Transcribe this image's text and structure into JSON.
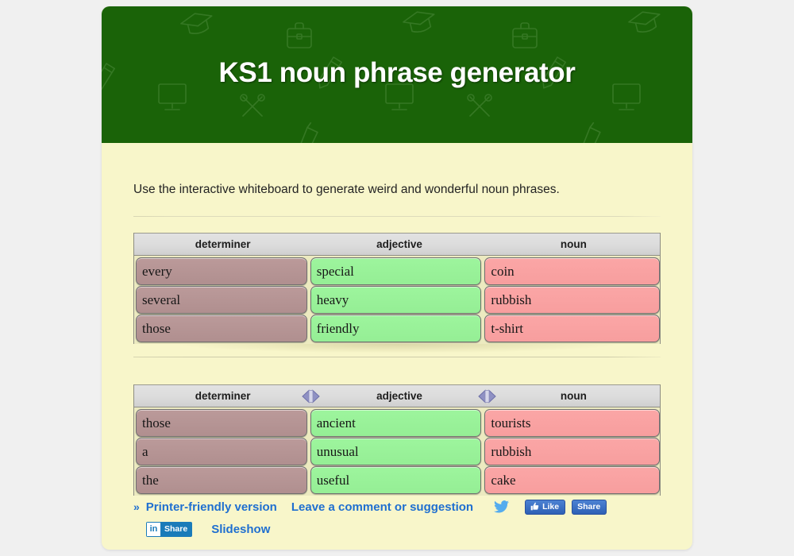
{
  "page": {
    "background_color": "#f0f0f0",
    "card_background": "#f8f6ca",
    "banner_color": "#1a6308",
    "accent_link_color": "#1f6fd0"
  },
  "banner": {
    "title": "KS1 noun phrase generator",
    "decorative_icons": [
      "graduation-cap-icon",
      "briefcase-icon",
      "pencil-icon",
      "monitor-icon",
      "scissors-icon",
      "paint-roller-icon"
    ]
  },
  "intro": {
    "text": "Use the interactive whiteboard to generate weird and wonderful noun phrases."
  },
  "boards": [
    {
      "name": "noun-phrase-board-1",
      "columns": [
        "determiner",
        "adjective",
        "noun"
      ],
      "has_resize_grips": false,
      "column_colors": [
        "#b99696",
        "#99f299",
        "#f9a2a2"
      ],
      "rows": [
        [
          "every",
          "special",
          "coin"
        ],
        [
          "several",
          "heavy",
          "rubbish"
        ],
        [
          "those",
          "friendly",
          "t-shirt"
        ]
      ]
    },
    {
      "name": "noun-phrase-board-2",
      "columns": [
        "determiner",
        "adjective",
        "noun"
      ],
      "has_resize_grips": true,
      "column_colors": [
        "#b99696",
        "#99f299",
        "#f9a2a2"
      ],
      "rows": [
        [
          "those",
          "ancient",
          "tourists"
        ],
        [
          "a",
          "unusual",
          "rubbish"
        ],
        [
          "the",
          "useful",
          "cake"
        ]
      ]
    }
  ],
  "footer": {
    "bullet": "»",
    "printer_link": "Printer-friendly version",
    "comment_link": "Leave a comment or suggestion",
    "slideshow_link": "Slideshow",
    "twitter_icon": "twitter-bird-icon",
    "facebook_like_label": "Like",
    "facebook_share_label": "Share",
    "linkedin_mark": "in",
    "linkedin_share_label": "Share"
  }
}
